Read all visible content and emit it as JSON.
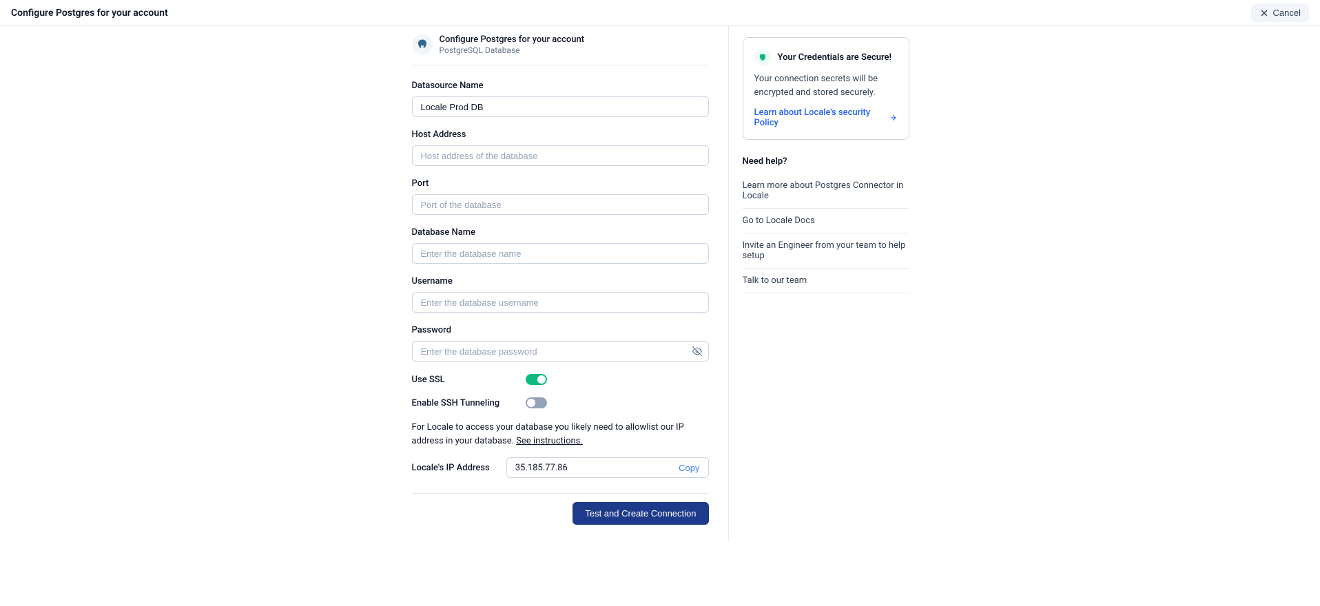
{
  "header": {
    "title": "Configure Postgres for your account",
    "cancel_label": "Cancel"
  },
  "form": {
    "header_title": "Configure Postgres for your account",
    "header_subtitle": "PostgreSQL Database",
    "datasource_name": {
      "label": "Datasource Name",
      "value": "Locale Prod DB"
    },
    "host_address": {
      "label": "Host Address",
      "placeholder": "Host address of the database"
    },
    "port": {
      "label": "Port",
      "placeholder": "Port of the database"
    },
    "database_name": {
      "label": "Database Name",
      "placeholder": "Enter the database name"
    },
    "username": {
      "label": "Username",
      "placeholder": "Enter the database username"
    },
    "password": {
      "label": "Password",
      "placeholder": "Enter the database password"
    },
    "use_ssl_label": "Use SSL",
    "enable_ssh_label": "Enable SSH Tunneling",
    "allowlist_text": "For Locale to access your database you likely need to allowlist our IP address in your database. ",
    "see_instructions": "See instructions.",
    "ip_label": "Locale's IP Address",
    "ip_value": "35.185.77.86",
    "copy_label": "Copy",
    "submit_label": "Test and Create Connection"
  },
  "sidebar": {
    "secure": {
      "title": "Your Credentials are Secure!",
      "desc": "Your connection secrets will be encrypted and stored securely.",
      "link": "Learn about Locale's security Policy"
    },
    "help_title": "Need help?",
    "help_items": [
      "Learn more about Postgres Connector in Locale",
      "Go to Locale Docs",
      "Invite an Engineer from your team to help setup",
      "Talk to our team"
    ]
  }
}
